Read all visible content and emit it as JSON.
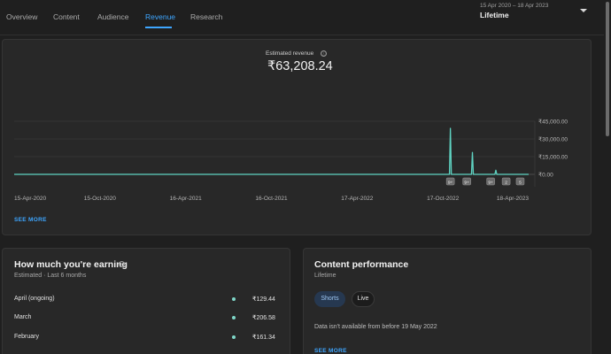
{
  "tabs": [
    {
      "label": "Overview"
    },
    {
      "label": "Content"
    },
    {
      "label": "Audience"
    },
    {
      "label": "Revenue"
    },
    {
      "label": "Research"
    }
  ],
  "active_tab": "Revenue",
  "date_range": {
    "range": "15 Apr 2020 – 18 Apr 2023",
    "label": "Lifetime"
  },
  "summary": {
    "label": "Estimated revenue",
    "value": "₹63,208.24",
    "info_icon": "ⓘ"
  },
  "chart_data": {
    "type": "line",
    "x_tick_labels": [
      "15-Apr-2020",
      "15-Oct-2020",
      "16-Apr-2021",
      "16-Oct-2021",
      "17-Apr-2022",
      "17-Oct-2022",
      "18-Apr-2023"
    ],
    "y_tick_labels": [
      "₹45,000.00",
      "₹30,000.00",
      "₹15,000.00",
      "₹0.00"
    ],
    "y_ticks": [
      45000,
      30000,
      15000,
      0
    ],
    "ylim": [
      0,
      45000
    ],
    "xlim": [
      "2020-04-15",
      "2023-04-18"
    ],
    "series": [
      {
        "color": "#5fd3c2",
        "points": [
          {
            "x": "2020-04-15",
            "y": 0
          },
          {
            "x": "2022-10-31",
            "y": 0
          },
          {
            "x": "2022-11-02",
            "y": 39000
          },
          {
            "x": "2022-11-04",
            "y": 0
          },
          {
            "x": "2022-12-17",
            "y": 0
          },
          {
            "x": "2022-12-19",
            "y": 18500
          },
          {
            "x": "2022-12-21",
            "y": 0
          },
          {
            "x": "2023-02-05",
            "y": 0
          },
          {
            "x": "2023-02-07",
            "y": 3500
          },
          {
            "x": "2023-02-09",
            "y": 0
          },
          {
            "x": "2023-04-18",
            "y": 0
          }
        ]
      }
    ],
    "markers": [
      {
        "x": "2022-11-02",
        "label": "9+"
      },
      {
        "x": "2022-12-07",
        "label": "9+"
      },
      {
        "x": "2023-01-27",
        "label": "9+"
      },
      {
        "x": "2023-03-01",
        "label": "2"
      },
      {
        "x": "2023-03-31",
        "label": "5"
      }
    ],
    "grid": true
  },
  "main_card": {
    "see_more": "SEE MORE"
  },
  "earning": {
    "title": "How much you're earning",
    "subtitle": "Estimated · Last 6 months",
    "rows": [
      {
        "label": "April (ongoing)",
        "value": "₹129.44"
      },
      {
        "label": "March",
        "value": "₹206.58"
      },
      {
        "label": "February",
        "value": "₹161.34"
      }
    ],
    "dot_color": "#7fd6c8"
  },
  "performance": {
    "title": "Content performance",
    "subtitle": "Lifetime",
    "chips": [
      {
        "label": "Shorts"
      },
      {
        "label": "Live"
      }
    ],
    "notice": "Data isn't available from before 19 May 2022",
    "see_more": "SEE MORE"
  },
  "icons": {
    "date_dropdown": "chevron-down-icon",
    "info": "info-icon"
  }
}
